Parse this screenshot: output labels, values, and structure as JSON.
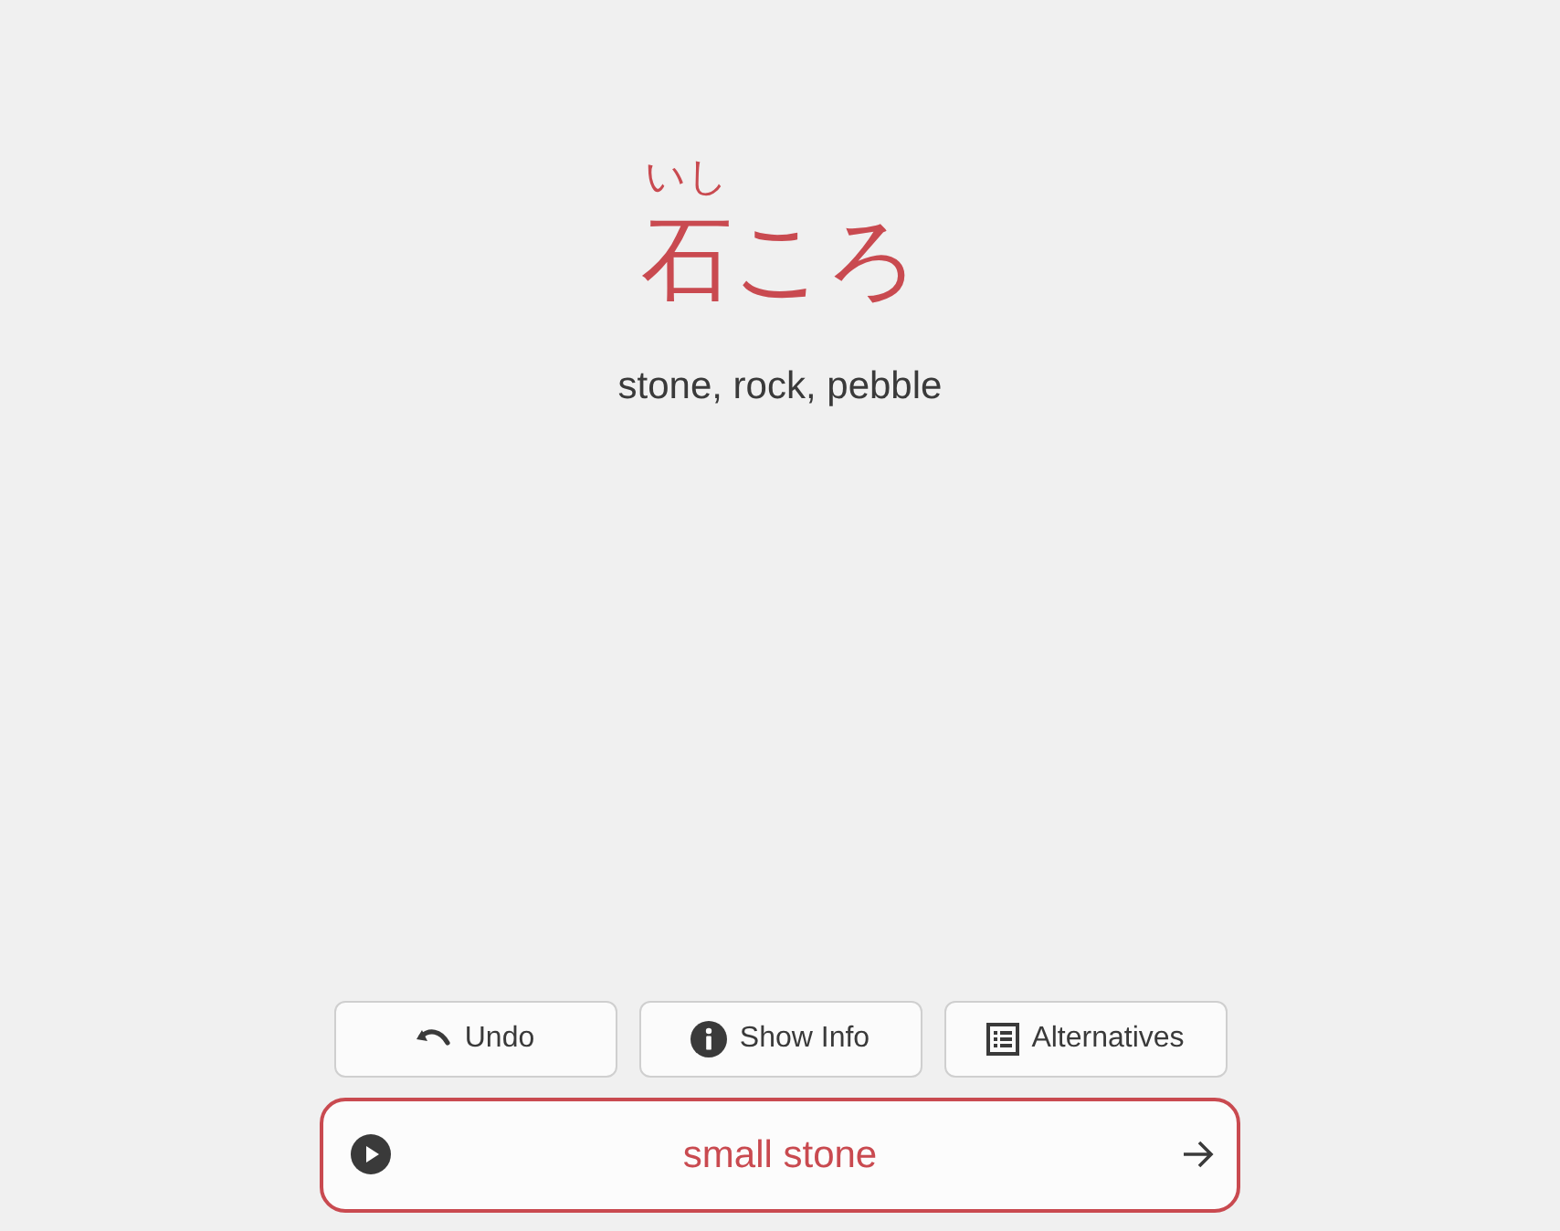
{
  "card": {
    "reading": "いし",
    "word": "石ころ",
    "meaning": "stone, rock, pebble"
  },
  "buttons": [
    {
      "kind": "undo",
      "label": "Undo"
    },
    {
      "kind": "info",
      "label": "Show Info"
    },
    {
      "kind": "list",
      "label": "Alternatives"
    }
  ],
  "answer": {
    "value": "small stone"
  }
}
